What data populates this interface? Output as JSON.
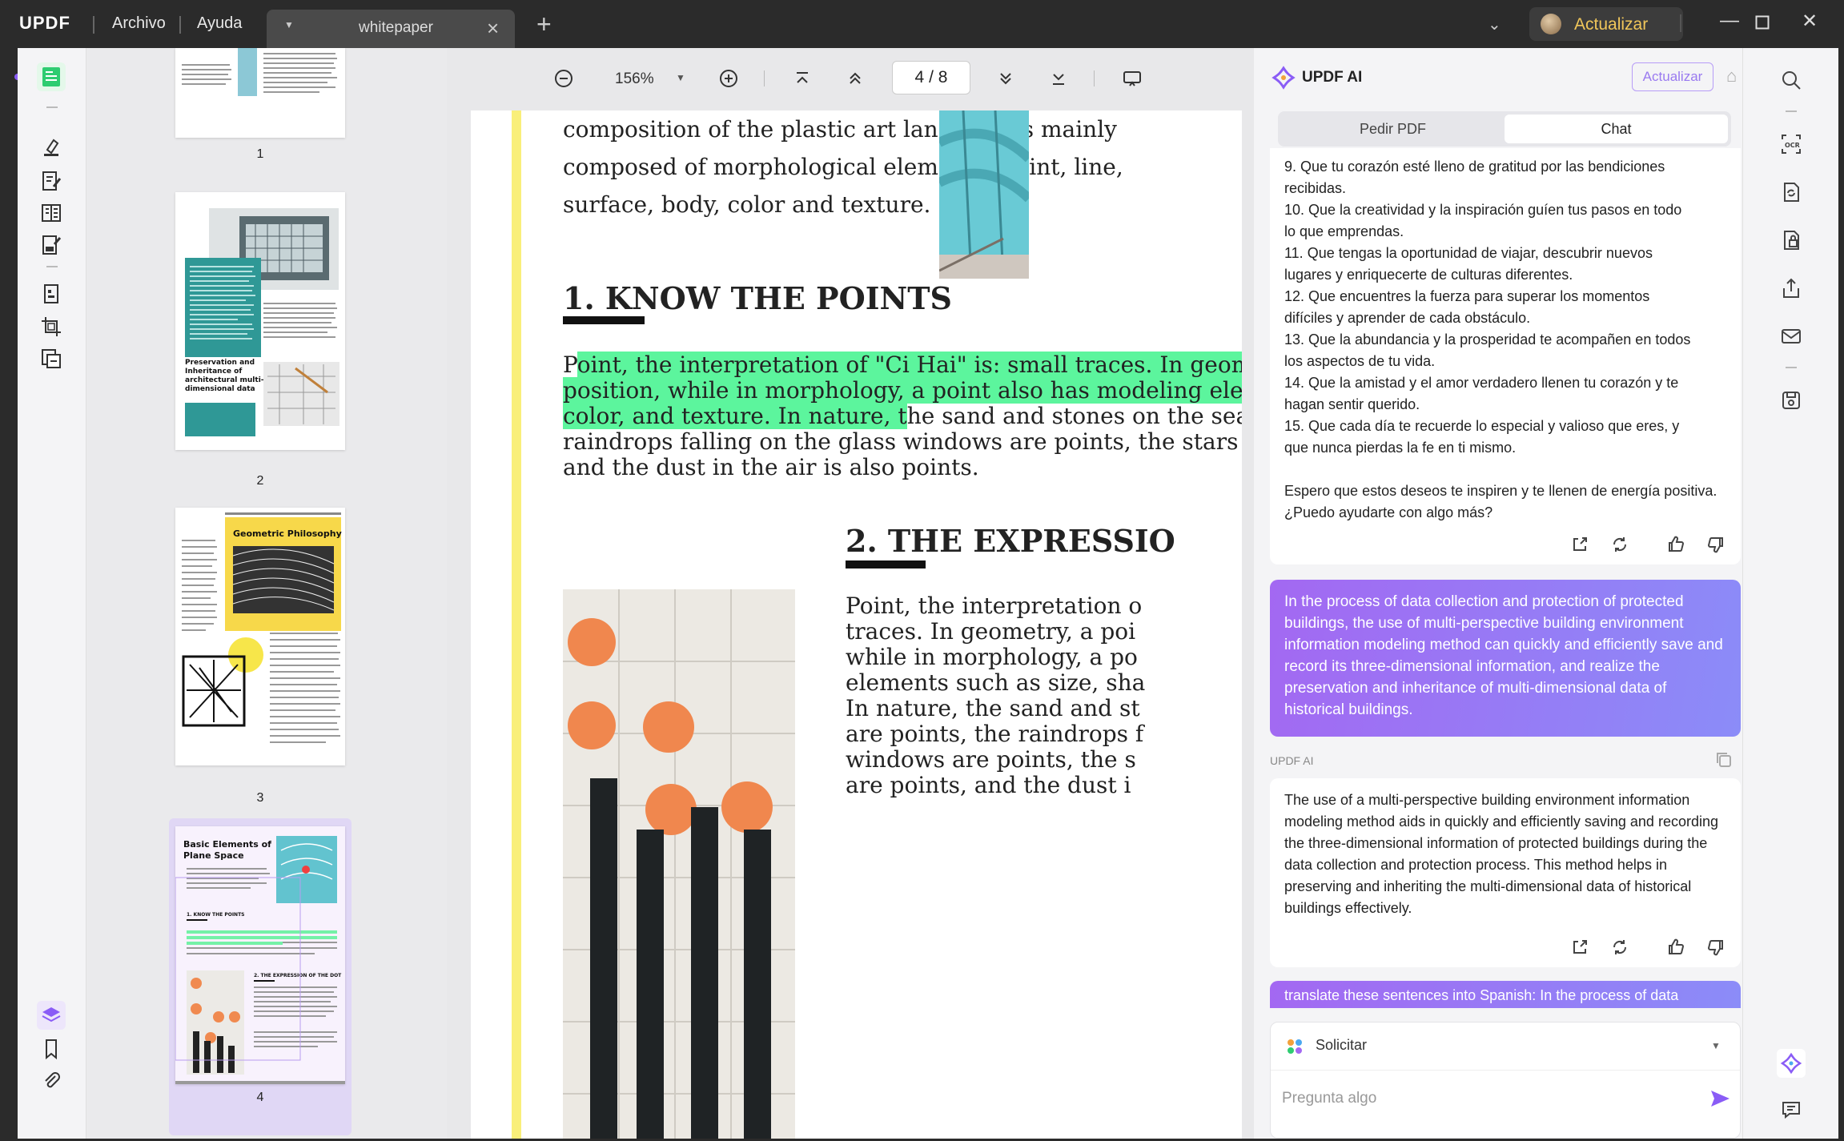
{
  "app": {
    "logo": "UPDF",
    "menus": [
      "Archivo",
      "Ayuda"
    ],
    "tab_title": "whitepaper",
    "upgrade_label": "Actualizar"
  },
  "toolbar": {
    "zoom": "156%",
    "page_current": "4",
    "page_separator": "/",
    "page_total": "8"
  },
  "thumbnails": {
    "pages": [
      "1",
      "2",
      "3",
      "4"
    ],
    "page2_heading": "Preservation and Inheritance of architectural multi-dimensional data",
    "page3_heading": "Geometric Philosophy",
    "page4_heading": "Basic Elements of Plane Space",
    "page4_sub1": "1. KNOW THE POINTS",
    "page4_sub2": "2. THE EXPRESSION OF THE DOT"
  },
  "document": {
    "para1": [
      "composition of the plastic art language is mainly",
      "composed of morphological elements: point, line,",
      "surface, body, color and texture."
    ],
    "heading1": "1. KNOW THE POINTS",
    "para2_line1_plain": "P",
    "para2_line1_hl": "oint, the interpretation of \"Ci Hai\" is: small traces. In geometry, a",
    "para2_line2_hl": "position, while in morphology, a point also has modeling elements",
    "para2_line3_hl": "color, and texture. In nature, t",
    "para2_line3_plain": "he sand and stones on the seashore",
    "para2_line4": "raindrops falling on the glass windows are points, the stars in the",
    "para2_line5": "and the dust in the air is also points.",
    "heading2": "2. THE EXPRESSIO",
    "para3": [
      "Point, the interpretation o",
      "traces. In geometry, a poi",
      "while in morphology, a po",
      "elements such as size, sha",
      "In nature, the sand and st",
      "are points, the raindrops f",
      "windows are points, the s",
      "are points, and the dust i"
    ]
  },
  "ai": {
    "title": "UPDF AI",
    "upgrade": "Actualizar",
    "tabs": [
      "Pedir PDF",
      "Chat"
    ],
    "msg1_lines": [
      "9. Que tu corazón esté lleno de gratitud por las bendiciones",
      "recibidas.",
      "10. Que la creatividad y la inspiración guíen tus pasos en todo",
      "lo que emprendas.",
      "11. Que tengas la oportunidad de viajar, descubrir nuevos",
      "lugares y enriquecerte de culturas diferentes.",
      "12. Que encuentres la fuerza para superar los momentos",
      "difíciles y aprender de cada obstáculo.",
      "13. Que la abundancia y la prosperidad te acompañen en todos",
      "los aspectos de tu vida.",
      "14. Que la amistad y el amor verdadero llenen tu corazón y te",
      "hagan sentir querido.",
      "15. Que cada día te recuerde lo especial y valioso que eres, y",
      "que nunca pierdas la fe en ti mismo."
    ],
    "msg1_closing": "Espero que estos deseos te inspiren y te llenen de energía positiva. ¿Puedo ayudarte con algo más?",
    "user_msg": "In the process of data collection and protection of protected buildings, the use of multi-perspective building environment information modeling method can quickly and efficiently save and record its three-dimensional information, and realize the preservation and inheritance of multi-dimensional data of historical buildings.",
    "role_label": "UPDF AI",
    "msg2": "The use of a multi-perspective building environment information modeling method aids in quickly and efficiently saving and recording the three-dimensional information of protected buildings during the data collection and protection process. This method helps in preserving and inheriting the multi-dimensional data of historical buildings effectively.",
    "partial_msg": "translate these sentences into Spanish:  In the process of data",
    "mode_label": "Solicitar",
    "input_placeholder": "Pregunta algo"
  },
  "colors": {
    "accent_purple": "#8a5cf6",
    "highlight_green": "#5cf59d",
    "doc_yellow_bar": "#f9ef7a",
    "upgrade_gold": "#f0c65a"
  }
}
